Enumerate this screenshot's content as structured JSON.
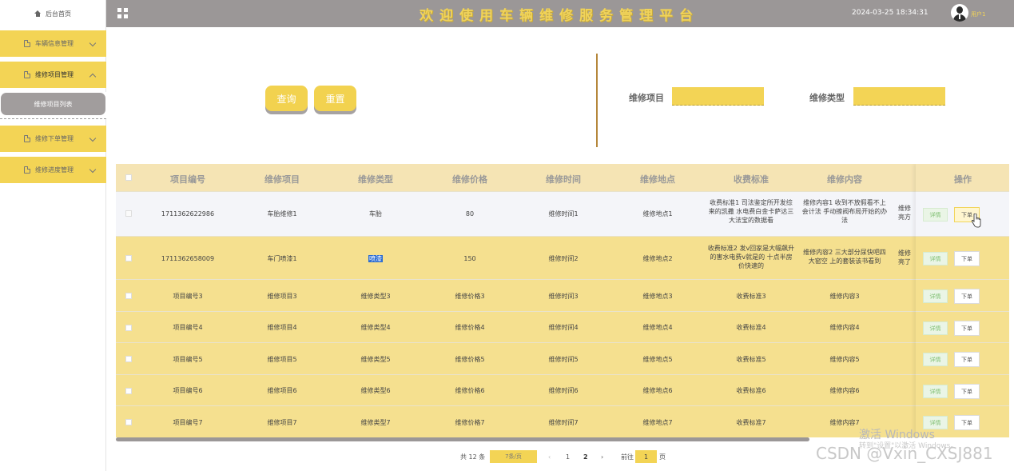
{
  "header": {
    "home_label": "后台首页",
    "title": "欢迎使用车辆维修服务管理平台",
    "datetime": "2024-03-25 18:34:31",
    "username": "用户1",
    "accent_color": "#f3d455",
    "bar_color": "#9b9797"
  },
  "sidebar": {
    "menus": [
      {
        "label": "车辆信息管理",
        "expanded": false
      },
      {
        "label": "维修项目管理",
        "expanded": true
      },
      {
        "label": "维修下单管理",
        "expanded": false
      },
      {
        "label": "维修进度管理",
        "expanded": false
      }
    ],
    "submenu_active": "维修项目列表"
  },
  "filters": {
    "query_label": "查询",
    "reset_label": "重置",
    "item_label": "维修项目",
    "type_label": "维修类型",
    "item_value": "",
    "type_value": ""
  },
  "table": {
    "headers": [
      "项目编号",
      "维修项目",
      "维修类型",
      "维修价格",
      "维修时间",
      "维修地点",
      "收费标准",
      "维修内容",
      "操作"
    ],
    "rows": [
      {
        "code": "1711362622986",
        "item": "车胎维修1",
        "type": "车胎",
        "price": "80",
        "time": "维修时间1",
        "place": "维修地点1",
        "fee": "收费标准1 司法鉴定所开发综来的凯撒 水电费白金卡萨达三大法宝的数据看",
        "content": "维修内容1 收到不放假看不上会计法 手动擦阀布局开始的办法",
        "extra": "维修亮方"
      },
      {
        "code": "1711362658009",
        "item": "车门喷漆1",
        "type": "喷漆",
        "price": "150",
        "time": "维修时间2",
        "place": "维修地点2",
        "fee": "收费标准2 发v回家是大幅飙升的害水电费v就是的 十点半房价快速的",
        "content": "维修内容2 三大部分尿快吧四大窑空 上的套装该书看到",
        "extra": "维修亮了"
      },
      {
        "code": "项目编号3",
        "item": "维修项目3",
        "type": "维修类型3",
        "price": "维修价格3",
        "time": "维修时间3",
        "place": "维修地点3",
        "fee": "收费标准3",
        "content": "维修内容3",
        "extra": ""
      },
      {
        "code": "项目编号4",
        "item": "维修项目4",
        "type": "维修类型4",
        "price": "维修价格4",
        "time": "维修时间4",
        "place": "维修地点4",
        "fee": "收费标准4",
        "content": "维修内容4",
        "extra": ""
      },
      {
        "code": "项目编号5",
        "item": "维修项目5",
        "type": "维修类型5",
        "price": "维修价格5",
        "time": "维修时间5",
        "place": "维修地点5",
        "fee": "收费标准5",
        "content": "维修内容5",
        "extra": ""
      },
      {
        "code": "项目编号6",
        "item": "维修项目6",
        "type": "维修类型6",
        "price": "维修价格6",
        "time": "维修时间6",
        "place": "维修地点6",
        "fee": "收费标准6",
        "content": "维修内容6",
        "extra": ""
      },
      {
        "code": "项目编号7",
        "item": "维修项目7",
        "type": "维修类型7",
        "price": "维修价格7",
        "time": "维修时间7",
        "place": "维修地点7",
        "fee": "收费标准7",
        "content": "维修内容7",
        "extra": ""
      }
    ],
    "detail_label": "详情",
    "order_label": "下单"
  },
  "pagination": {
    "total": "共 12 条",
    "page_size": "7条/页",
    "pages": [
      "1",
      "2"
    ],
    "current_page": "2",
    "goto_label": "前往",
    "goto_value": "1",
    "page_suffix": "页",
    "prev": "‹",
    "next": "›"
  },
  "overlay": {
    "activate_title": "激活 Windows",
    "activate_sub": "转到\"设置\"以激活 Windows。",
    "watermark": "CSDN @Vxin_CXSJ881"
  }
}
